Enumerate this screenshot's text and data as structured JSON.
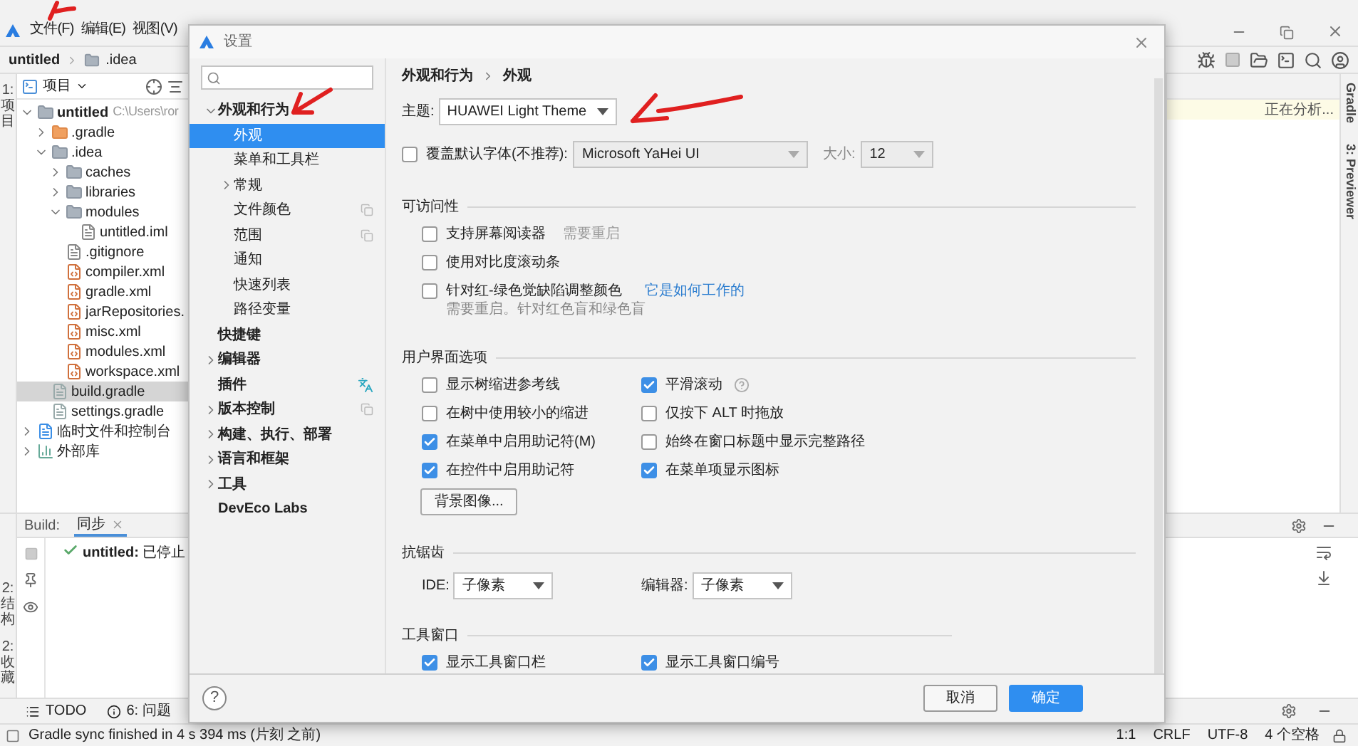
{
  "menu": [
    "文件(F)",
    "编辑(E)",
    "视图(V)"
  ],
  "breadcrumb": [
    "untitled",
    ".idea"
  ],
  "left_strip_top": [
    "1: 项目"
  ],
  "project_panel": {
    "title": "项目",
    "tree": [
      {
        "label": "untitled",
        "path": "C:\\Users\\ror",
        "kind": "module",
        "expanded": true,
        "selected": false,
        "children": [
          {
            "label": ".gradle",
            "kind": "excluded-folder",
            "expanded": false,
            "selected": false
          },
          {
            "label": ".idea",
            "kind": "folder",
            "expanded": true,
            "selected": false,
            "children": [
              {
                "label": "caches",
                "kind": "folder",
                "expanded": false,
                "selected": false
              },
              {
                "label": "libraries",
                "kind": "folder",
                "expanded": false,
                "selected": false
              },
              {
                "label": "modules",
                "kind": "folder",
                "expanded": true,
                "selected": false,
                "children": [
                  {
                    "label": "untitled.iml",
                    "kind": "iml",
                    "selected": false
                  }
                ]
              },
              {
                "label": ".gitignore",
                "kind": "ignore",
                "selected": false
              },
              {
                "label": "compiler.xml",
                "kind": "xml",
                "selected": false
              },
              {
                "label": "gradle.xml",
                "kind": "xml",
                "selected": false
              },
              {
                "label": "jarRepositories.",
                "kind": "xml",
                "selected": false
              },
              {
                "label": "misc.xml",
                "kind": "xml",
                "selected": false
              },
              {
                "label": "modules.xml",
                "kind": "xml",
                "selected": false
              },
              {
                "label": "workspace.xml",
                "kind": "xml",
                "selected": false
              }
            ]
          },
          {
            "label": "build.gradle",
            "kind": "gradle",
            "selected": true
          },
          {
            "label": "settings.gradle",
            "kind": "gradle",
            "selected": false
          }
        ]
      },
      {
        "label": "临时文件和控制台",
        "kind": "scratches",
        "expanded": false,
        "selected": false
      },
      {
        "label": "外部库",
        "kind": "libraries",
        "expanded": false,
        "selected": false
      }
    ]
  },
  "editor": {
    "notice": "正在分析..."
  },
  "right_strip": [
    "Gradle",
    "3: Previewer"
  ],
  "build": {
    "label": "Build:",
    "tabs": [
      {
        "label": "同步",
        "selected": true
      }
    ],
    "message": {
      "name": "untitled:",
      "status": "已停止"
    }
  },
  "left_strip_bottom": [
    "2: 结构",
    "2: 收藏"
  ],
  "tool_tabs": [
    {
      "label": "TODO",
      "kind": "todo"
    },
    {
      "label": "6: 问题",
      "kind": "problems"
    }
  ],
  "status_bar": {
    "message": "Gradle sync finished in 4 s 394 ms (片刻 之前)",
    "items": [
      "1:1",
      "CRLF",
      "UTF-8",
      "4 个空格"
    ]
  },
  "dialog": {
    "title": "设置",
    "nav": [
      {
        "label": "外观和行为",
        "expanded": true,
        "selected": false,
        "children": [
          {
            "label": "外观",
            "selected": true
          },
          {
            "label": "菜单和工具栏",
            "selected": false
          },
          {
            "label": "常规",
            "expanded": false,
            "selected": false
          },
          {
            "label": "文件颜色",
            "kind": "project",
            "selected": false
          },
          {
            "label": "范围",
            "kind": "project",
            "selected": false
          },
          {
            "label": "通知",
            "selected": false
          },
          {
            "label": "快速列表",
            "selected": false
          },
          {
            "label": "路径变量",
            "selected": false
          }
        ]
      },
      {
        "label": "快捷键",
        "selected": false
      },
      {
        "label": "编辑器",
        "expanded": false,
        "selected": false
      },
      {
        "label": "插件",
        "kind": "translate",
        "selected": false
      },
      {
        "label": "版本控制",
        "expanded": false,
        "kind": "project",
        "selected": false
      },
      {
        "label": "构建、执行、部署",
        "expanded": false,
        "selected": false
      },
      {
        "label": "语言和框架",
        "expanded": false,
        "selected": false
      },
      {
        "label": "工具",
        "expanded": false,
        "selected": false
      },
      {
        "label": "DevEco Labs",
        "selected": false
      }
    ],
    "breadcrumb": [
      "外观和行为",
      "外观"
    ],
    "theme": {
      "label": "主题:",
      "value": "HUAWEI Light Theme"
    },
    "font": {
      "checked": false,
      "label": "覆盖默认字体(不推荐):",
      "value": "Microsoft YaHei UI",
      "size_label": "大小:",
      "size": "12"
    },
    "accessibility": {
      "title": "可访问性",
      "items": [
        {
          "label": "支持屏幕阅读器",
          "checked": false,
          "note": "需要重启"
        },
        {
          "label": "使用对比度滚动条",
          "checked": false
        },
        {
          "label": "针对红-绿色觉缺陷调整颜色",
          "checked": false,
          "link": "它是如何工作的",
          "hint": "需要重启。针对红色盲和绿色盲"
        }
      ]
    },
    "ui_options": {
      "title": "用户界面选项",
      "items": [
        {
          "label": "显示树缩进参考线",
          "checked": false
        },
        {
          "label": "平滑滚动",
          "checked": true,
          "help": true
        },
        {
          "label": "在树中使用较小的缩进",
          "checked": false
        },
        {
          "label": "仅按下 ALT 时拖放",
          "checked": false
        },
        {
          "label": "在菜单中启用助记符(M)",
          "checked": true
        },
        {
          "label": "始终在窗口标题中显示完整路径",
          "checked": false
        },
        {
          "label": "在控件中启用助记符",
          "checked": true
        },
        {
          "label": "在菜单项显示图标",
          "checked": true
        }
      ],
      "button": "背景图像..."
    },
    "antialiasing": {
      "title": "抗锯齿",
      "selects": [
        {
          "label": "IDE:",
          "value": "子像素"
        },
        {
          "label": "编辑器:",
          "value": "子像素"
        }
      ]
    },
    "tool_windows": {
      "title": "工具窗口",
      "items": [
        {
          "label": "显示工具窗口栏",
          "checked": true
        },
        {
          "label": "显示工具窗口编号",
          "checked": true
        }
      ]
    },
    "help": "?",
    "buttons": [
      {
        "label": "取消",
        "kind": "secondary"
      },
      {
        "label": "确定",
        "kind": "primary"
      }
    ]
  }
}
